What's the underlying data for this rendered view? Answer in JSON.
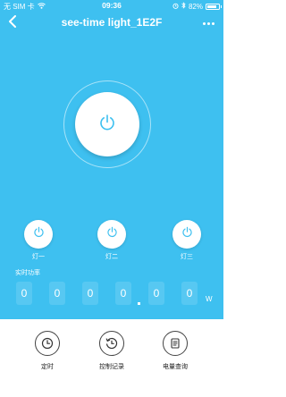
{
  "status_bar": {
    "carrier": "无 SIM 卡",
    "time": "09:36",
    "battery": "82%",
    "battery_level": 0.82
  },
  "nav": {
    "title": "see-time light_1E2F",
    "back_icon": "chevron-left-icon",
    "more_icon": "more-dots-icon"
  },
  "main_power": {
    "icon": "power-icon"
  },
  "lights": [
    {
      "label": "灯一"
    },
    {
      "label": "灯二"
    },
    {
      "label": "灯三"
    }
  ],
  "power_meter": {
    "label": "实时功率",
    "digits": [
      "0",
      "0",
      "0",
      "0",
      "0",
      "0"
    ],
    "unit": "W"
  },
  "footer": {
    "items": [
      {
        "label": "定时",
        "icon": "clock-icon"
      },
      {
        "label": "控制记录",
        "icon": "history-icon"
      },
      {
        "label": "电量查询",
        "icon": "report-icon"
      }
    ]
  },
  "colors": {
    "primary": "#3ec0f0",
    "background": "#ffffff",
    "text_dark": "#222222"
  }
}
